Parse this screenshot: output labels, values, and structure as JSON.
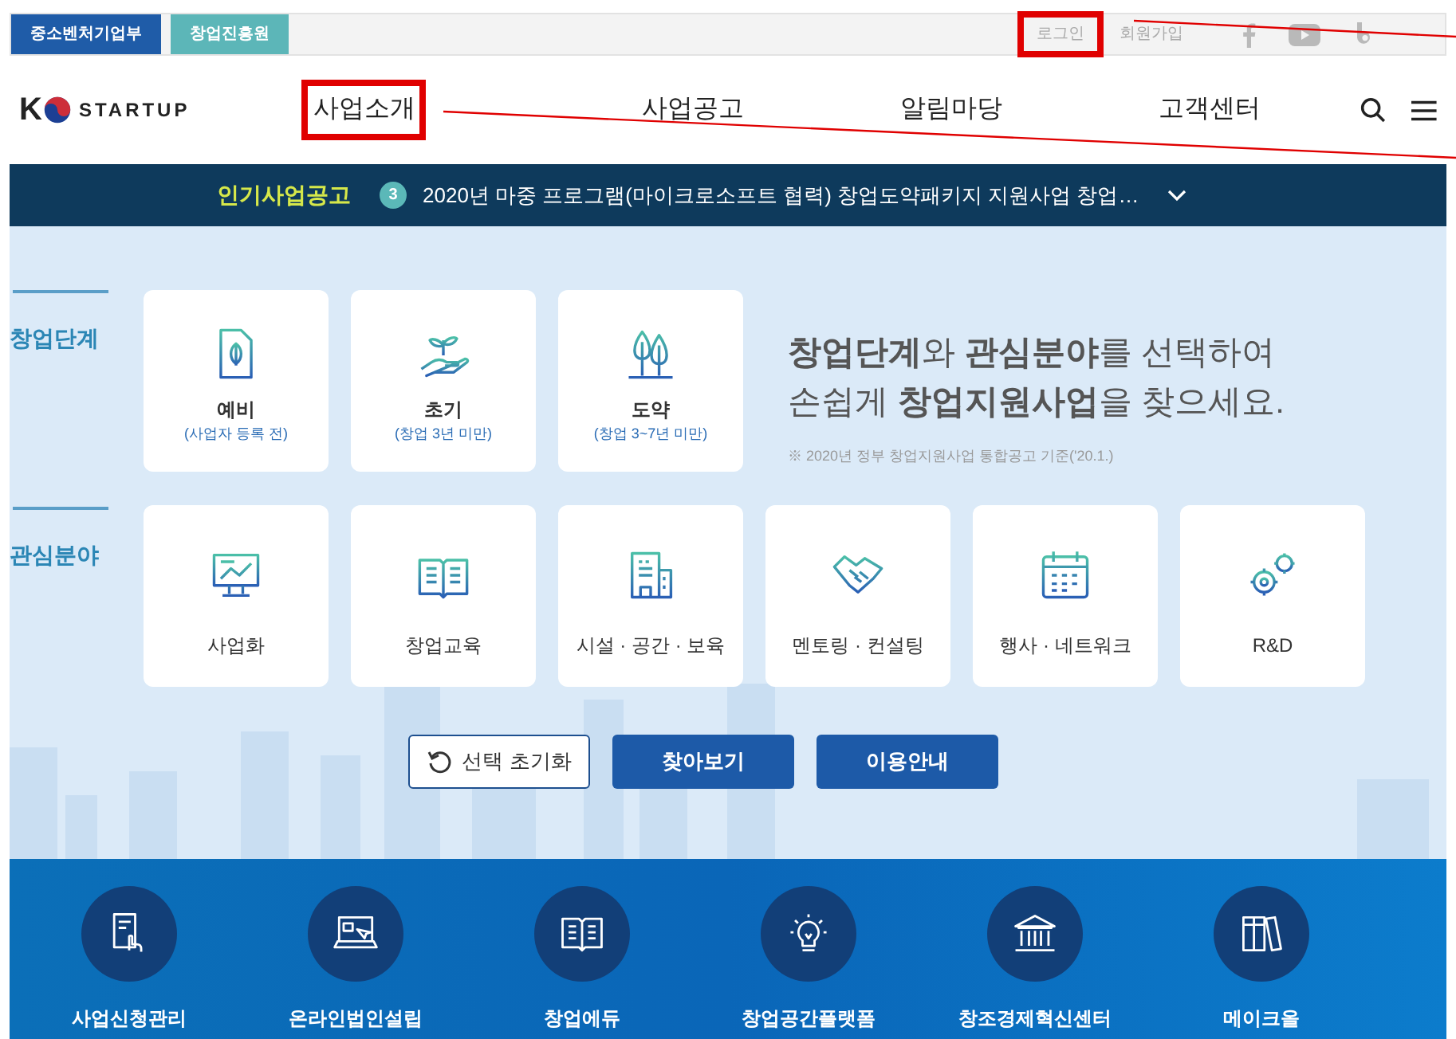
{
  "top_bar": {
    "sites": [
      {
        "label": "중소벤처기업부",
        "selected": true
      },
      {
        "label": "창업진흥원",
        "selected": false
      }
    ],
    "links": [
      {
        "label": "로그인",
        "highlighted": true
      },
      {
        "label": "회원가입",
        "highlighted": false
      }
    ]
  },
  "header": {
    "logo": {
      "letter": "K",
      "word": "STARTUP"
    },
    "nav": [
      {
        "label": "사업소개",
        "highlighted": true
      },
      {
        "label": "사업공고",
        "highlighted": false
      },
      {
        "label": "알림마당",
        "highlighted": false
      },
      {
        "label": "고객센터",
        "highlighted": false
      }
    ]
  },
  "ticker": {
    "label": "인기사업공고",
    "rank": "3",
    "text": "2020년 마중 프로그램(마이크로소프트 협력) 창업도약패키지 지원사업 창업…"
  },
  "finder": {
    "stage_label": "창업단계",
    "stages": [
      {
        "title": "예비",
        "subtitle": "(사업자 등록 전)"
      },
      {
        "title": "초기",
        "subtitle": "(창업 3년 미만)"
      },
      {
        "title": "도약",
        "subtitle": "(창업 3~7년 미만)"
      }
    ],
    "headline": [
      "**창업단계**와 **관심분야**를 선택하여",
      "손쉽게 **창업지원사업**을 찾으세요."
    ],
    "note": "※ 2020년 정부 창업지원사업 통합공고 기준('20.1.)",
    "field_label": "관심분야",
    "fields": [
      "사업화",
      "창업교육",
      "시설 · 공간 · 보육",
      "멘토링 · 컨설팅",
      "행사 · 네트워크",
      "R&D"
    ],
    "buttons": [
      {
        "label": "선택 초기화",
        "kind": "reset"
      },
      {
        "label": "찾아보기",
        "kind": "primary"
      },
      {
        "label": "이용안내",
        "kind": "primary"
      }
    ]
  },
  "quick_links": [
    "사업신청관리",
    "온라인법인설립",
    "창업에듀",
    "창업공간플랫폼",
    "창조경제혁신센터",
    "메이크올"
  ]
}
